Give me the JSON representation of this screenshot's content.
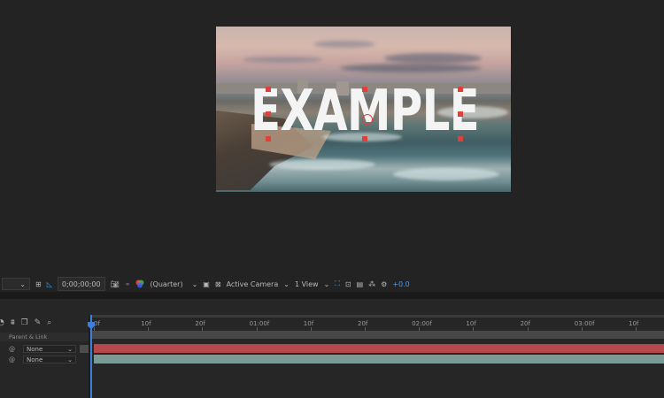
{
  "composition": {
    "overlay_text": "EXAMPLE"
  },
  "viewer_toolbar": {
    "timecode": "0;00;00;00",
    "resolution": "(Quarter)",
    "camera": "Active Camera",
    "views": "1 View",
    "exposure": "+0.0"
  },
  "timeline": {
    "column_header": "Parent & Link",
    "ruler_labels": [
      "0f",
      "10f",
      "20f",
      "01:00f",
      "10f",
      "20f",
      "02:00f",
      "10f",
      "20f",
      "03:00f",
      "10f"
    ],
    "layers": [
      {
        "parent": "None",
        "bar_color": "#b5484b"
      },
      {
        "parent": "None",
        "bar_color": "#7a9a95"
      }
    ]
  },
  "colors": {
    "accent": "#3d7fd6",
    "handle": "#e0403a"
  }
}
